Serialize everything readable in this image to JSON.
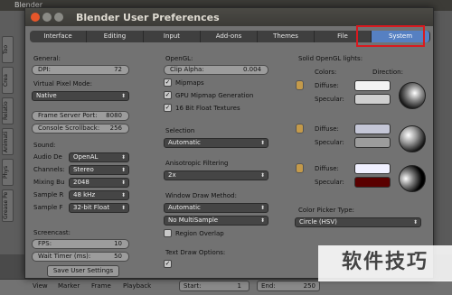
{
  "background": {
    "title": "Blender",
    "side_tabs": [
      "Too",
      "Crea",
      "Relatio",
      "Animati",
      "Phys",
      "Grease Pe"
    ],
    "bottom_bar": {
      "menu": [
        "View",
        "Marker",
        "Frame",
        "Playback"
      ],
      "start_label": "Start:",
      "start_value": "1",
      "end_label": "End:",
      "end_value": "250",
      "save_button": "Save User Settings"
    }
  },
  "dialog": {
    "title": "Blender User Preferences",
    "tabs": [
      "Interface",
      "Editing",
      "Input",
      "Add-ons",
      "Themes",
      "File",
      "System"
    ],
    "active_tab": "System"
  },
  "general": {
    "heading": "General:",
    "dpi_label": "DPI:",
    "dpi_value": "72",
    "vpm_label": "Virtual Pixel Mode:",
    "vpm_value": "Native",
    "frame_server_label": "Frame Server Port:",
    "frame_server_value": "8080",
    "console_label": "Console Scrollback:",
    "console_value": "256"
  },
  "sound": {
    "heading": "Sound:",
    "rows": [
      {
        "label": "Audio De",
        "value": "OpenAL"
      },
      {
        "label": "Channels:",
        "value": "Stereo"
      },
      {
        "label": "Mixing Bu",
        "value": "2048"
      },
      {
        "label": "Sample R",
        "value": "48 kHz"
      },
      {
        "label": "Sample F",
        "value": "32-bit Float"
      }
    ]
  },
  "screencast": {
    "heading": "Screencast:",
    "fps_label": "FPS:",
    "fps_value": "10",
    "wait_label": "Wait Timer (ms):",
    "wait_value": "50"
  },
  "opengl": {
    "heading": "OpenGL:",
    "clip_alpha_label": "Clip Alpha:",
    "clip_alpha_value": "0.004",
    "mipmaps": "Mipmaps",
    "gpu_mipmap": "GPU Mipmap Generation",
    "float_textures": "16 Bit Float Textures"
  },
  "selection": {
    "heading": "Selection",
    "value": "Automatic"
  },
  "anisotropic": {
    "heading": "Anisotropic Filtering",
    "value": "2x"
  },
  "window_draw": {
    "heading": "Window Draw Method:",
    "method": "Automatic",
    "multisample": "No MultiSample",
    "region_overlap": "Region Overlap"
  },
  "text_draw": {
    "heading": "Text Draw Options:"
  },
  "solid_lights": {
    "heading": "Solid OpenGL lights:",
    "colors_label": "Colors:",
    "direction_label": "Direction:",
    "diffuse_label": "Diffuse:",
    "specular_label": "Specular:",
    "lights": [
      {
        "diffuse": "#f2f2f2",
        "specular": "#cfcfcf"
      },
      {
        "diffuse": "#c4c6d6",
        "specular": "#9c9c9c"
      },
      {
        "diffuse": "#f0f0ff",
        "specular": "#5a0000"
      }
    ]
  },
  "color_picker": {
    "heading": "Color Picker Type:",
    "value": "Circle (HSV)"
  },
  "watermark": "软件技巧"
}
